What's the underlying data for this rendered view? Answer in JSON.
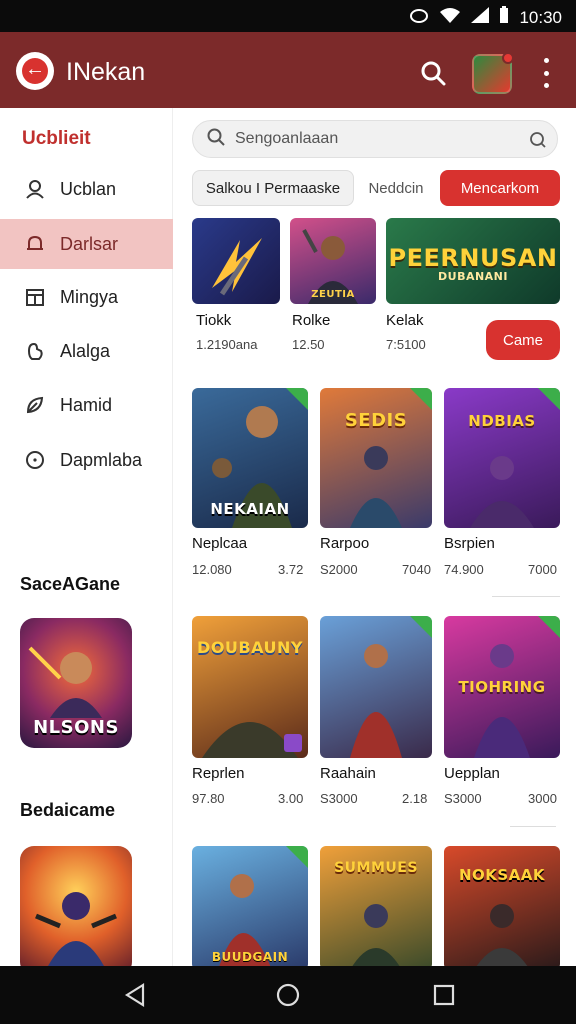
{
  "status": {
    "time": "10:30"
  },
  "appbar": {
    "title": "INekan"
  },
  "sidebar": {
    "heading": "Ucblieit",
    "items": [
      {
        "label": "Ucblan",
        "icon": "person-icon"
      },
      {
        "label": "Darlsar",
        "icon": "bell-icon",
        "active": true
      },
      {
        "label": "Mingya",
        "icon": "calendar-icon"
      },
      {
        "label": "Alalga",
        "icon": "hand-icon"
      },
      {
        "label": "Hamid",
        "icon": "leaf-icon"
      },
      {
        "label": "Dapmlaba",
        "icon": "info-icon"
      }
    ],
    "section1": {
      "title": "SaceAGane",
      "art_text": "NLSONS"
    },
    "section2": {
      "title": "Bedaicame"
    }
  },
  "search": {
    "placeholder": "Sengoanlaaan"
  },
  "chips": {
    "chip1": "Salkou I Permaaske",
    "chip2": "Neddcin",
    "chip3": "Mencarkom"
  },
  "featured": [
    {
      "name": "Tiokk",
      "meta": "1.2190ana"
    },
    {
      "name": "Rolke",
      "meta": "12.50",
      "art_text": "ZEUTIA"
    },
    {
      "name": "Kelak",
      "meta": "7:5100",
      "art_text": "PEERNUSAN",
      "art_sub": "DUBANANI"
    }
  ],
  "featured_button": "Came",
  "grid": [
    {
      "name": "Neplcaa",
      "meta_left": "12.080",
      "meta_right": "3.72",
      "art_text": "NEKAIAN"
    },
    {
      "name": "Rarpoo",
      "meta_left": "S2000",
      "meta_right": "7040",
      "art_text": "SEDIS"
    },
    {
      "name": "Bsrpien",
      "meta_left": "74.900",
      "meta_right": "7000",
      "art_text": "NDBIAS"
    },
    {
      "name": "Reprlen",
      "meta_left": "97.80",
      "meta_right": "3.00",
      "art_text": "DOUBAUNY"
    },
    {
      "name": "Raahain",
      "meta_left": "S3000",
      "meta_right": "2.18",
      "art_text": ""
    },
    {
      "name": "Uepplan",
      "meta_left": "S3000",
      "meta_right": "3000",
      "art_text": "TIOHRING"
    },
    {
      "name": "",
      "meta_left": "",
      "meta_right": "",
      "art_text": "BUUDGAIN"
    },
    {
      "name": "",
      "meta_left": "",
      "meta_right": "",
      "art_text": "SUMMUES"
    },
    {
      "name": "",
      "meta_left": "",
      "meta_right": "",
      "art_text": "NOKSAAK"
    }
  ],
  "colors": {
    "appbar": "#7c2a2a",
    "accent": "#d8322f",
    "active_bg": "#f2c4c2"
  }
}
